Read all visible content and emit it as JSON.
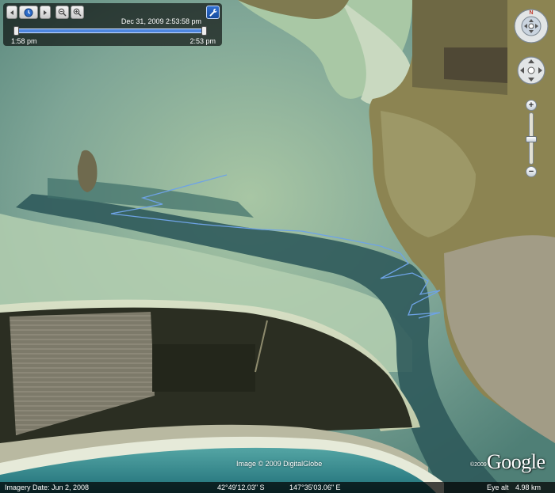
{
  "time_slider": {
    "current_time": "Dec 31, 2009  2:53:58 pm",
    "start_label": "1:58 pm",
    "end_label": "2:53 pm",
    "position": 1.0
  },
  "map": {
    "attribution": "Image © 2009 DigitalGlobe",
    "logo_copyright": "©2009",
    "logo": "Google"
  },
  "status_bar": {
    "imagery_date": "Imagery Date: Jun  2, 2008",
    "latitude": "42°49'12.03\" S",
    "longitude": "147°35'03.06\" E",
    "eye_alt_label": "Eye alt",
    "eye_alt_value": "4.98 km"
  },
  "colors": {
    "gps_track": "#6ea3e6",
    "shallow_water": "#a9c7a4",
    "deep_channel": "#2f5a5b",
    "farmland": "#8c8452",
    "forest": "#2b2e22"
  },
  "icons": [
    "skip-back-icon",
    "clock-icon",
    "skip-forward-icon",
    "zoom-out-icon",
    "zoom-in-icon",
    "wrench-icon",
    "look-around-icon",
    "move-icon"
  ]
}
